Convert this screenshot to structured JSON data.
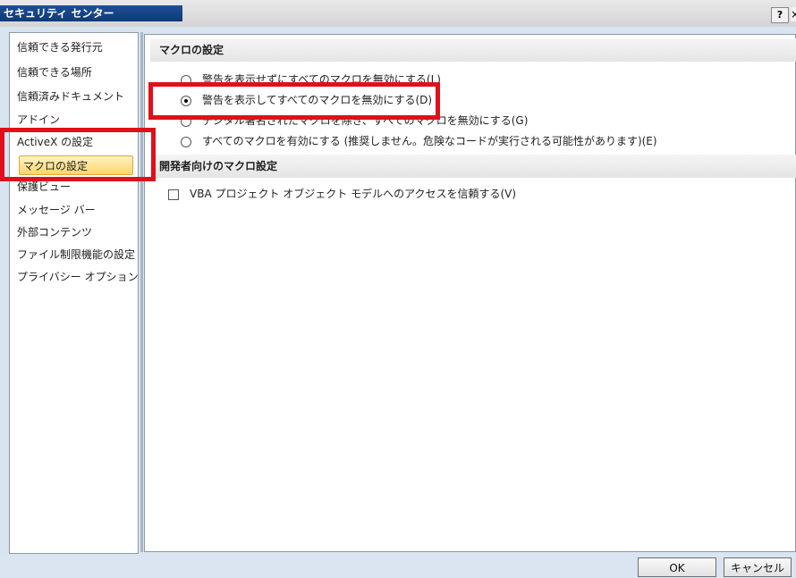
{
  "window": {
    "title": "セキュリティ センター",
    "help_label": "?",
    "close_label": "×"
  },
  "sidebar": {
    "items": [
      {
        "label": "信頼できる発行元"
      },
      {
        "label": "信頼できる場所"
      },
      {
        "label": "信頼済みドキュメント"
      },
      {
        "label": "アドイン"
      },
      {
        "label": "ActiveX の設定"
      },
      {
        "label": "マクロの設定",
        "selected": true
      },
      {
        "label": "保護ビュー"
      },
      {
        "label": "メッセージ バー"
      },
      {
        "label": "外部コンテンツ"
      },
      {
        "label": "ファイル制限機能の設定"
      },
      {
        "label": "プライバシー オプション"
      }
    ]
  },
  "macro_settings": {
    "header": "マクロの設定",
    "options": [
      {
        "label": "警告を表示せずにすべてのマクロを無効にする(L)",
        "checked": false
      },
      {
        "label": "警告を表示してすべてのマクロを無効にする(D)",
        "checked": true
      },
      {
        "label": "デジタル署名されたマクロを除き、すべてのマクロを無効にする(G)",
        "checked": false
      },
      {
        "label": "すべてのマクロを有効にする (推奨しません。危険なコードが実行される可能性があります)(E)",
        "checked": false
      }
    ]
  },
  "developer_settings": {
    "header": "開発者向けのマクロ設定",
    "checkbox_label": "VBA プロジェクト オブジェクト モデルへのアクセスを信頼する(V)",
    "checked": false
  },
  "footer": {
    "ok_label": "OK",
    "cancel_label": "キャンセル"
  },
  "colors": {
    "highlight": "#e0101a",
    "selected_bg": "#ffd46b",
    "title_bg": "#0d3b7a"
  }
}
